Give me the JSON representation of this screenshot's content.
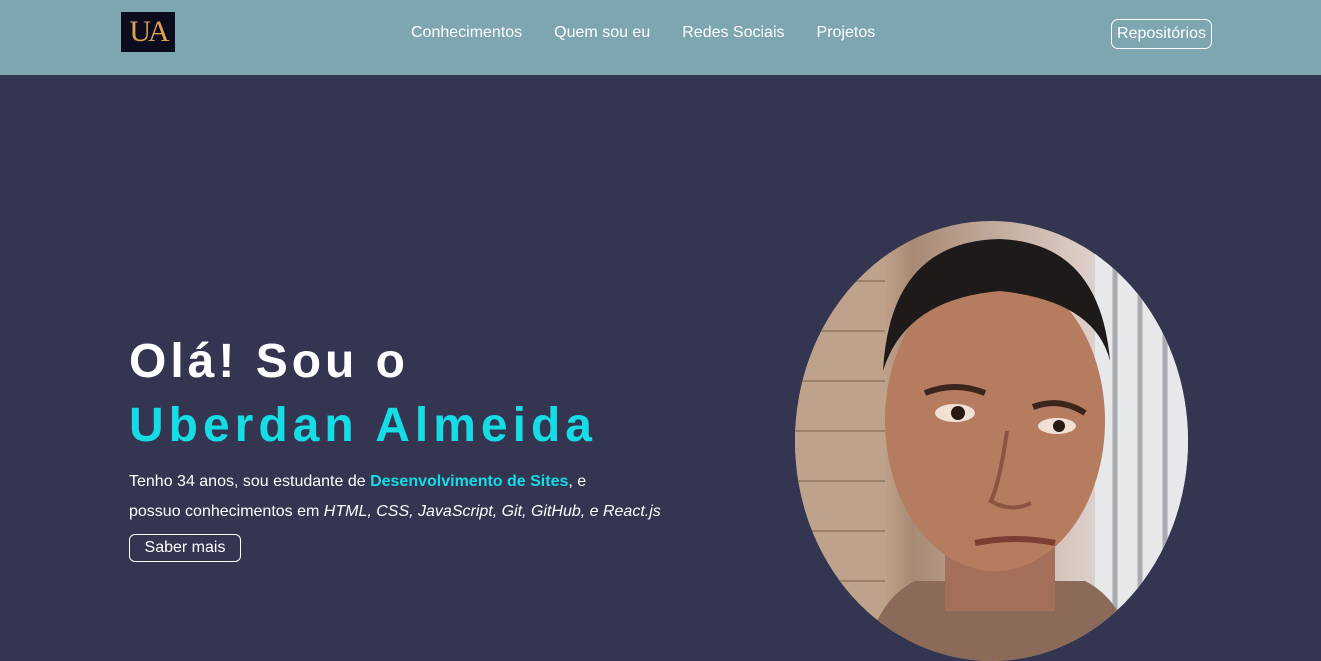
{
  "header": {
    "logo_text": "UA",
    "nav": [
      "Conhecimentos",
      "Quem sou eu",
      "Redes Sociais",
      "Projetos"
    ],
    "repo_label": "Repositórios"
  },
  "hero": {
    "greeting": "Olá! Sou o",
    "name": "Uberdan Almeida",
    "desc_1": "Tenho 34 anos, sou estudante de ",
    "desc_highlight": "Desenvolvimento de Sites",
    "desc_2": ", e",
    "desc_3": "possuo conhecimentos em ",
    "desc_skills": "HTML, CSS, JavaScript, Git, GitHub, e React.js",
    "button_label": "Saber mais"
  },
  "colors": {
    "navbar": "#7ea6b0",
    "background": "#333551",
    "accent": "#16dce6"
  }
}
